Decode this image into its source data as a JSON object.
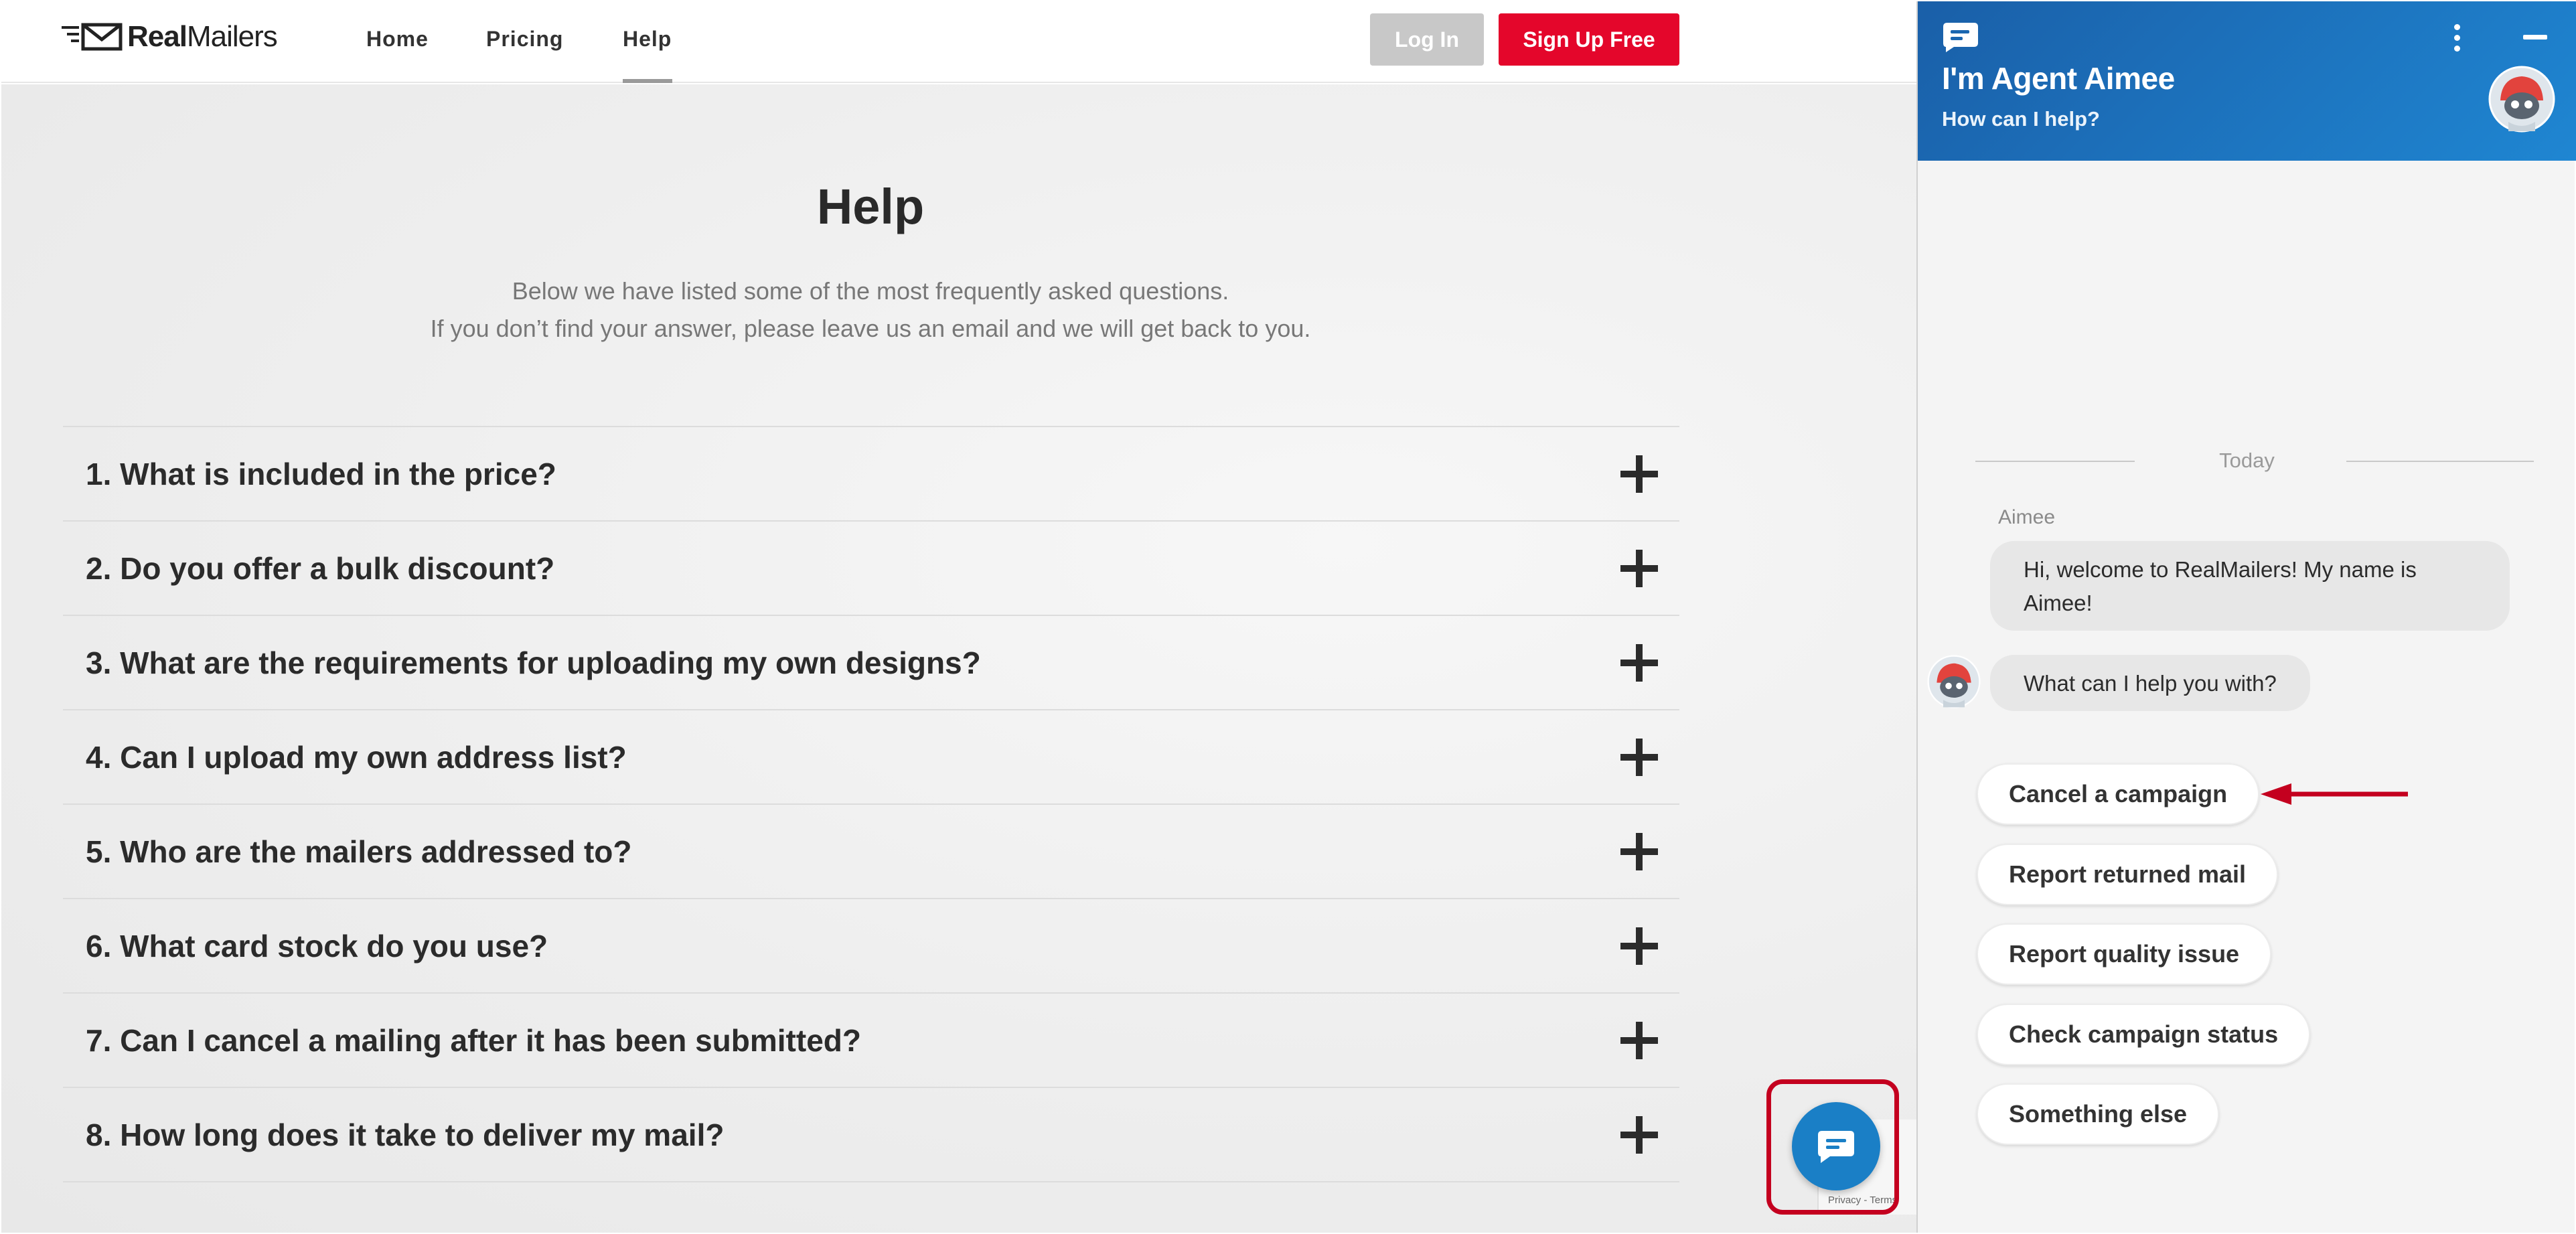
{
  "header": {
    "logo": {
      "bold": "Real",
      "rest": "Mailers"
    },
    "nav": [
      {
        "label": "Home"
      },
      {
        "label": "Pricing"
      },
      {
        "label": "Help"
      }
    ],
    "login_label": "Log In",
    "signup_label": "Sign Up Free"
  },
  "help": {
    "title": "Help",
    "intro_line1": "Below we have listed some of the most frequently asked questions.",
    "intro_line2": "If you don’t find your answer, please leave us an email and we will get back to you.",
    "faqs": [
      "1. What is included in the price?",
      "2. Do you offer a bulk discount?",
      "3. What are the requirements for uploading my own designs?",
      "4. Can I upload my own address list?",
      "5. Who are the mailers addressed to?",
      "6. What card stock do you use?",
      "7. Can I cancel a mailing after it has been submitted?",
      "8. How long does it take to deliver my mail?"
    ]
  },
  "recaptcha_text": "Privacy - Terms",
  "chat": {
    "title": "I'm Agent Aimee",
    "subtitle": "How can I help?",
    "date_divider": "Today",
    "sender": "Aimee",
    "messages": [
      "Hi, welcome to RealMailers! My name is Aimee!",
      "What can I help you with?"
    ],
    "quick_replies": [
      "Cancel a campaign",
      "Report returned mail",
      "Report quality issue",
      "Check campaign status",
      "Something else"
    ]
  },
  "colors": {
    "brand_red": "#e4062b",
    "chat_blue": "#1f86d2",
    "annotation_red": "#c4001f"
  },
  "icons": [
    "mail-logo-icon",
    "plus-icon",
    "chat-bubble-icon",
    "more-vert-icon",
    "minimize-icon",
    "robot-avatar-icon",
    "red-arrow-annotation"
  ]
}
